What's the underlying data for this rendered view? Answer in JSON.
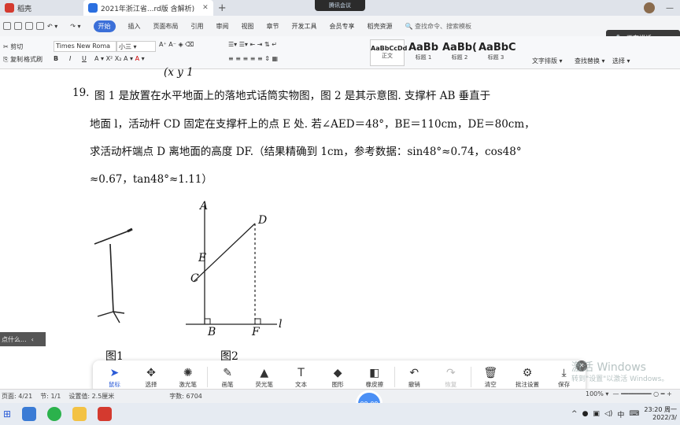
{
  "tabs": [
    {
      "label": "稻壳",
      "color": "#d43a2f"
    },
    {
      "label": "2021年浙江省...rd版 含解析)",
      "color": "#2b6fe0"
    }
  ],
  "meeting_label": "腾讯会议",
  "menu": {
    "items": [
      "开始",
      "插入",
      "页面布局",
      "引用",
      "审阅",
      "视图",
      "章节",
      "开发工具",
      "会员专享",
      "稻壳资源"
    ],
    "search_placeholder": "查找命令、搜索模板",
    "selected": "开始"
  },
  "ribbon": {
    "cut": "剪切",
    "copy": "复制",
    "format_painter": "格式刷",
    "font_name": "Times New Roma",
    "font_size": "小三",
    "styles": [
      {
        "sample": "AaBbCcDd",
        "name": "正文"
      },
      {
        "sample": "AaBb",
        "name": "标题 1"
      },
      {
        "sample": "AaBb(",
        "name": "标题 2"
      },
      {
        "sample": "AaBbC",
        "name": "标题 3"
      }
    ],
    "text_layout": "文字排版",
    "find_replace": "查找替换",
    "select": "选择"
  },
  "speaking_label": "正在讲话:",
  "document": {
    "prev_line": "(x  y   1",
    "q_number": "19.",
    "lines": [
      "图 1 是放置在水平地面上的落地式话筒实物图，图 2 是其示意图. 支撑杆 AB 垂直于",
      "地面 l，活动杆 CD 固定在支撑杆上的点 E 处. 若∠AED＝48°，BE＝110cm，DE＝80cm，",
      "求活动杆端点 D 离地面的高度 DF.（结果精确到 1cm，参考数据：sin48°≈0.74，cos48°",
      "≈0.67，tan48°≈1.11）"
    ],
    "fig_points": {
      "A": "A",
      "B": "B",
      "C": "C",
      "D": "D",
      "E": "E",
      "F": "F",
      "l": "l"
    },
    "fig1_caption": "图1",
    "fig2_caption": "图2"
  },
  "left_tip": "点什么...",
  "draw_tools": [
    {
      "icon": "cursor-icon",
      "glyph": "➤",
      "label": "鼠标",
      "state": "selected"
    },
    {
      "icon": "move-icon",
      "glyph": "✥",
      "label": "选择",
      "state": "normal"
    },
    {
      "icon": "laser-pointer-icon",
      "glyph": "✺",
      "label": "激光笔",
      "state": "normal"
    },
    {
      "icon": "pen-icon",
      "glyph": "✎",
      "label": "画笔",
      "state": "normal"
    },
    {
      "icon": "highlighter-icon",
      "glyph": "▲",
      "label": "荧光笔",
      "state": "normal"
    },
    {
      "icon": "text-icon",
      "glyph": "T",
      "label": "文本",
      "state": "normal"
    },
    {
      "icon": "shape-icon",
      "glyph": "◆",
      "label": "图形",
      "state": "normal"
    },
    {
      "icon": "eraser-icon",
      "glyph": "◧",
      "label": "橡皮擦",
      "state": "normal"
    },
    {
      "icon": "undo-icon",
      "glyph": "↶",
      "label": "撤销",
      "state": "normal"
    },
    {
      "icon": "redo-icon",
      "glyph": "↷",
      "label": "恢复",
      "state": "disabled"
    },
    {
      "icon": "trash-icon",
      "glyph": "🗑",
      "label": "清空",
      "state": "normal"
    },
    {
      "icon": "annotation-settings-icon",
      "glyph": "⚙",
      "label": "批注设置",
      "state": "normal"
    },
    {
      "icon": "save-icon",
      "glyph": "⤓",
      "label": "保存",
      "state": "normal"
    }
  ],
  "record_label": "00:00",
  "status": {
    "page": "页面: 4/21",
    "section": "节: 1/1",
    "setting": "设置值: 2.5厘米",
    "words": "字数: 6704"
  },
  "watermark": "激活 Windows",
  "watermark_sub": "转到\"设置\"以激活 Windows。",
  "zoom": "100%",
  "clock": {
    "time": "23:20 周一",
    "date": "2022/3/"
  },
  "ime": "中"
}
